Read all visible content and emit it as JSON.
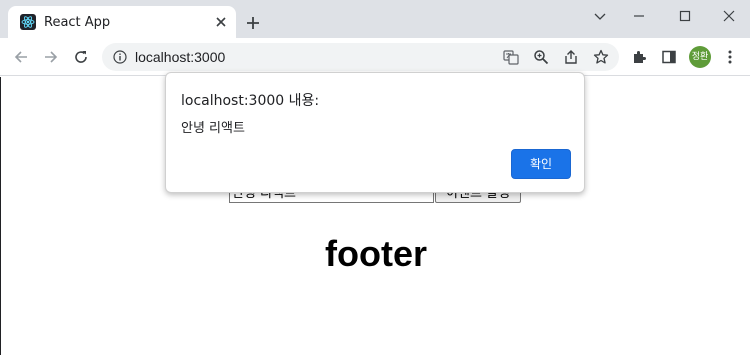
{
  "browser": {
    "tab": {
      "title": "React App",
      "favicon": "react-atom-icon"
    },
    "new_tab_icon": "plus-icon",
    "window_controls": [
      "chevron-down-icon",
      "minimize-icon",
      "maximize-icon",
      "close-icon"
    ],
    "url": "localhost:3000",
    "profile_initials": "정환",
    "accent_color": "#1a73e8"
  },
  "page": {
    "input_value": "안녕 리액트",
    "button_label": "이벤트 발생",
    "footer_heading": "footer"
  },
  "dialog": {
    "title": "localhost:3000 내용:",
    "message": "안녕 리액트",
    "ok_label": "확인"
  }
}
